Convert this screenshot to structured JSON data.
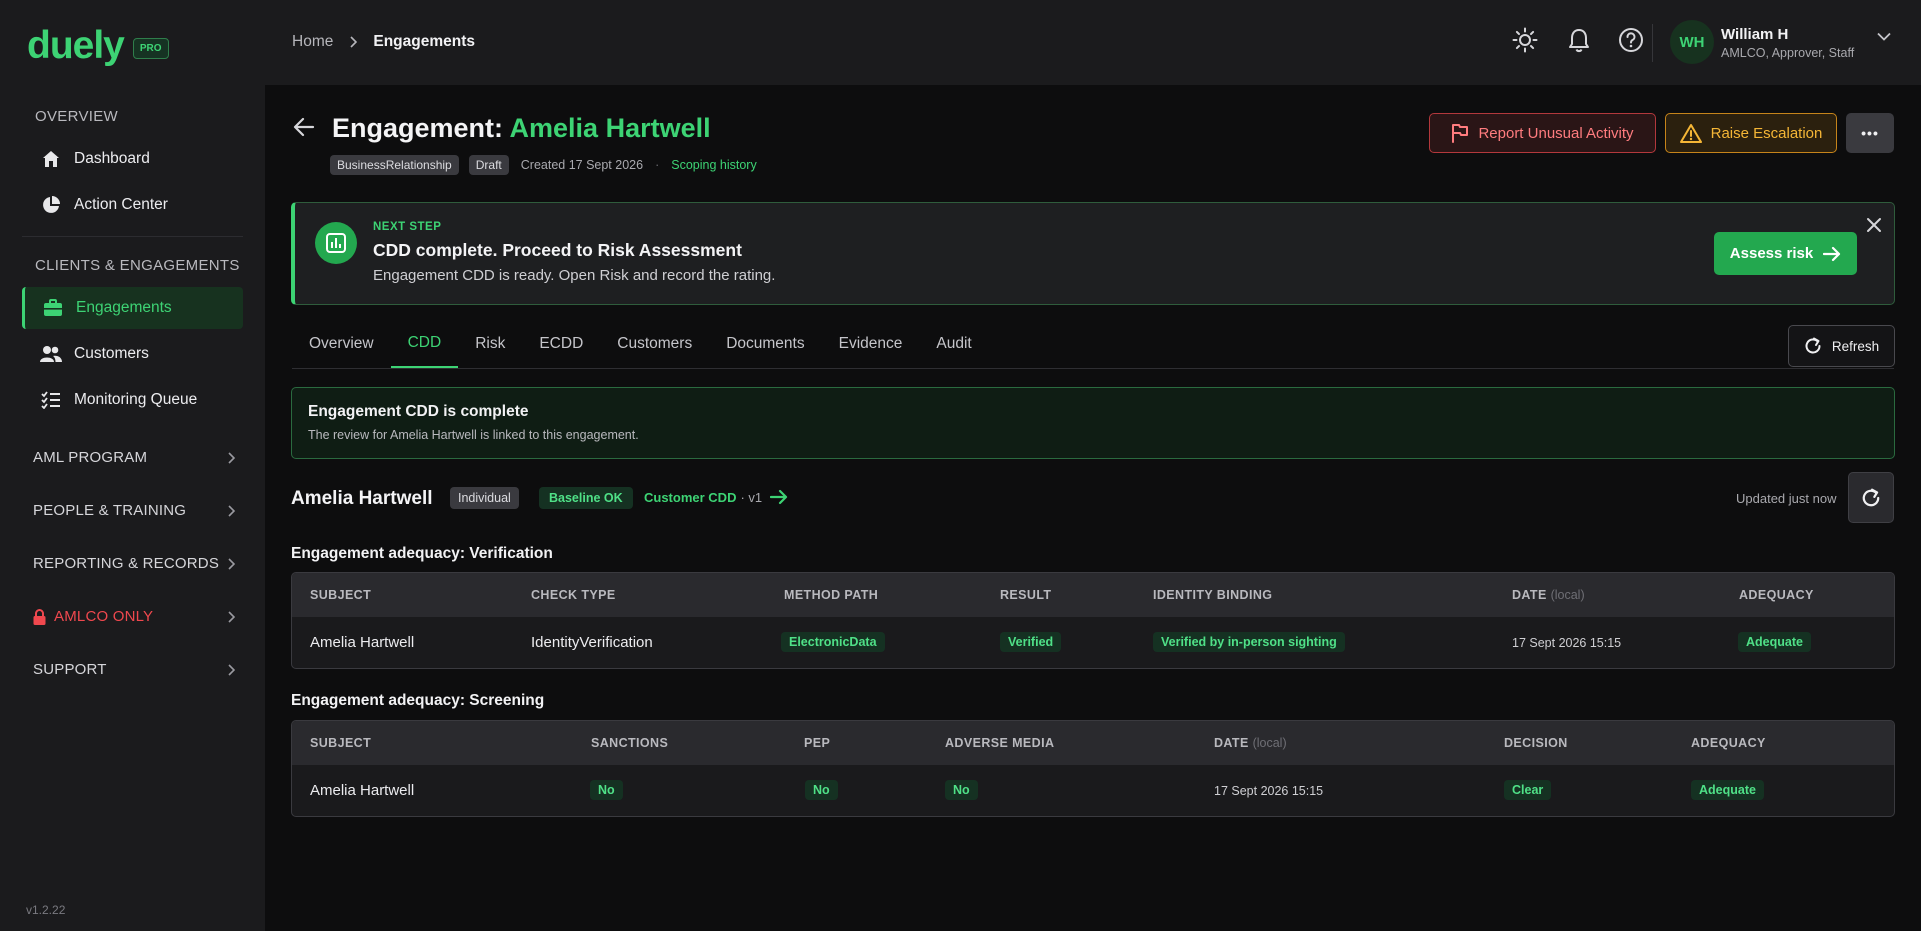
{
  "brand": {
    "logo": "duely",
    "badge": "PRO"
  },
  "sidebar": {
    "overview_heading": "OVERVIEW",
    "overview_items": [
      {
        "label": "Dashboard",
        "icon": "home-icon"
      },
      {
        "label": "Action Center",
        "icon": "pie-chart-icon"
      }
    ],
    "clients_heading": "CLIENTS & ENGAGEMENTS",
    "clients_items": [
      {
        "label": "Engagements",
        "icon": "briefcase-icon",
        "active": true
      },
      {
        "label": "Customers",
        "icon": "users-icon"
      },
      {
        "label": "Monitoring Queue",
        "icon": "list-check-icon"
      }
    ],
    "groups": [
      {
        "label": "AML PROGRAM"
      },
      {
        "label": "PEOPLE & TRAINING"
      },
      {
        "label": "REPORTING & RECORDS"
      },
      {
        "label": "AMLCO ONLY",
        "danger": true
      },
      {
        "label": "SUPPORT"
      }
    ],
    "version": "v1.2.22"
  },
  "topbar": {
    "breadcrumb_home": "Home",
    "breadcrumb_sep": ">",
    "breadcrumb_current": "Engagements",
    "icons": [
      "sun-icon",
      "bell-icon",
      "help-icon"
    ],
    "user": {
      "initials": "WH",
      "name": "William H",
      "roles": "AMLCO, Approver, Staff"
    }
  },
  "page": {
    "title_prefix": "Engagement: ",
    "title_name": "Amelia Hartwell",
    "chips": [
      "BusinessRelationship",
      "Draft"
    ],
    "created": "Created 17 Sept 2026",
    "meta_dot": "·",
    "scoping_link": "Scoping history",
    "actions": {
      "report": "Report Unusual Activity",
      "escalate": "Raise Escalation",
      "more": "•••"
    },
    "colors": {
      "accent": "#3dd374",
      "danger": "#ff7c7f",
      "warning": "#f5b636"
    }
  },
  "next_step": {
    "label": "NEXT STEP",
    "title": "CDD complete. Proceed to Risk Assessment",
    "description": "Engagement CDD is ready. Open Risk and record the rating.",
    "button": "Assess risk"
  },
  "tabs": {
    "items": [
      "Overview",
      "CDD",
      "Risk",
      "ECDD",
      "Customers",
      "Documents",
      "Evidence",
      "Audit"
    ],
    "active": "CDD",
    "refresh": "Refresh"
  },
  "cdd_status": {
    "title": "Engagement CDD is complete",
    "description": "The review for Amelia Hartwell is linked to this engagement."
  },
  "subject": {
    "name": "Amelia Hartwell",
    "type": "Individual",
    "baseline": "Baseline OK",
    "customer_cdd": "Customer CDD",
    "version": "· v1",
    "updated": "Updated just now"
  },
  "verification": {
    "title": "Engagement adequacy: Verification",
    "headers": {
      "subject": "SUBJECT",
      "check_type": "CHECK TYPE",
      "method_path": "METHOD PATH",
      "result": "RESULT",
      "identity_binding": "IDENTITY BINDING",
      "date": "DATE",
      "date_note": "(local)",
      "adequacy": "ADEQUACY"
    },
    "row": {
      "subject": "Amelia Hartwell",
      "check_type": "IdentityVerification",
      "method_path": "ElectronicData",
      "result": "Verified",
      "identity_binding": "Verified by in-person sighting",
      "date": "17 Sept 2026 15:15",
      "adequacy": "Adequate"
    }
  },
  "screening": {
    "title": "Engagement adequacy: Screening",
    "headers": {
      "subject": "SUBJECT",
      "sanctions": "SANCTIONS",
      "pep": "PEP",
      "adverse_media": "ADVERSE MEDIA",
      "date": "DATE",
      "date_note": "(local)",
      "decision": "DECISION",
      "adequacy": "ADEQUACY"
    },
    "row": {
      "subject": "Amelia Hartwell",
      "sanctions": "No",
      "pep": "No",
      "adverse_media": "No",
      "date": "17 Sept 2026 15:15",
      "decision": "Clear",
      "adequacy": "Adequate"
    }
  }
}
